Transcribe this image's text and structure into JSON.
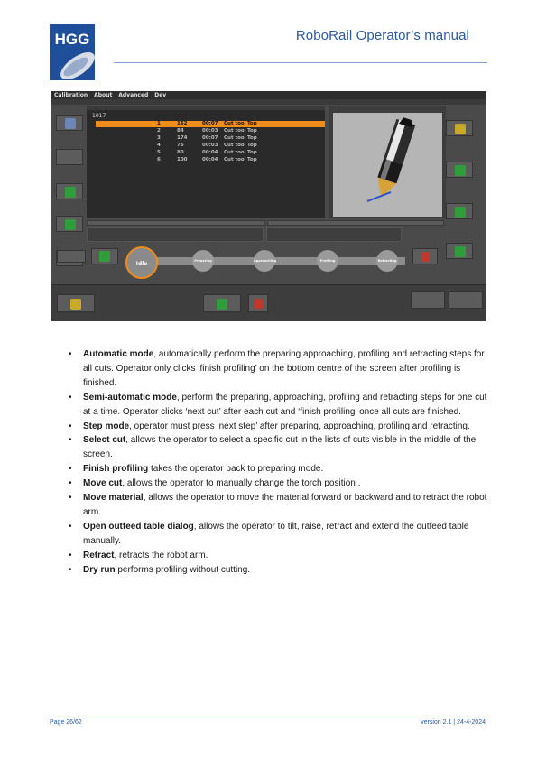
{
  "header": {
    "logo_text": "HGG",
    "title": "RoboRail Operator’s manual"
  },
  "screenshot": {
    "menu": [
      "Calibration",
      "About",
      "Advanced",
      "Dev"
    ],
    "job_id": "1017",
    "rows": [
      {
        "no": "1",
        "len": "162",
        "time": "00:07",
        "tool": "Cut tool",
        "side": "Top",
        "selected": true
      },
      {
        "no": "2",
        "len": "84",
        "time": "00:03",
        "tool": "Cut tool",
        "side": "Top",
        "selected": false
      },
      {
        "no": "3",
        "len": "174",
        "time": "00:07",
        "tool": "Cut tool",
        "side": "Top",
        "selected": false
      },
      {
        "no": "4",
        "len": "76",
        "time": "00:03",
        "tool": "Cut tool",
        "side": "Top",
        "selected": false
      },
      {
        "no": "5",
        "len": "80",
        "time": "00:04",
        "tool": "Cut tool",
        "side": "Top",
        "selected": false
      },
      {
        "no": "6",
        "len": "100",
        "time": "00:04",
        "tool": "Cut tool",
        "side": "Top",
        "selected": false
      }
    ],
    "flow_steps": [
      "Idle",
      "Preparing",
      "Approaching",
      "Profiling",
      "Retracting"
    ]
  },
  "bullets": [
    {
      "term": "Automatic mode",
      "text": ", automatically perform the preparing approaching, profiling and retracting steps for all cuts. Operator only clicks ‘finish profiling’ on the bottom centre of the screen after profiling is finished."
    },
    {
      "term": "Semi-automatic mode",
      "text": ", perform the preparing, approaching, profiling and retracting steps for one cut at a time. Operator clicks ‘next cut’ after each cut and ‘finish profiling’ once all cuts are finished."
    },
    {
      "term": "Step mode",
      "text": ", operator must press ‘next step’ after preparing, approaching, profiling and retracting."
    },
    {
      "term": "Select cut",
      "text": ", allows the operator to select a specific cut in the lists of cuts visible in the middle of the screen."
    },
    {
      "term": "Finish profiling",
      "text": " takes the operator back to preparing mode."
    },
    {
      "term": "Move cut",
      "text": ", allows the operator to manually change the torch position ."
    },
    {
      "term": "Move material",
      "text": ", allows the operator to move the material forward or backward and to retract the robot arm."
    },
    {
      "term": "Open outfeed table dialog",
      "text": ", allows the operator to tilt, raise, retract and extend the outfeed table manually."
    },
    {
      "term": "Retract",
      "text": ", retracts the robot arm."
    },
    {
      "term": "Dry run",
      "text": " performs profiling without cutting."
    }
  ],
  "footer": {
    "page": "Page 26/62",
    "version": "version 2.1 |  24-4-2024"
  },
  "colors": {
    "brand_blue": "#2a5aa3",
    "selected_row": "#f08c1a"
  }
}
